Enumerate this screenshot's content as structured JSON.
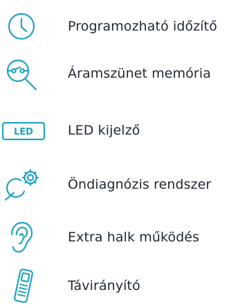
{
  "colors": {
    "accent": "#1fa3c2",
    "text": "#1f2833",
    "background": "#ffffff"
  },
  "features": [
    {
      "icon": "clock-icon",
      "label": "Programozható időzítő"
    },
    {
      "icon": "power-memory-icon",
      "label": "Áramszünet memória"
    },
    {
      "icon": "led-display-icon",
      "label": "LED kijelző",
      "badge_text": "LED"
    },
    {
      "icon": "self-diagnosis-gear-icon",
      "label": "Öndiagnózis rendszer"
    },
    {
      "icon": "ear-icon",
      "label": "Extra halk működés"
    },
    {
      "icon": "remote-control-icon",
      "label": "Távirányító"
    }
  ]
}
